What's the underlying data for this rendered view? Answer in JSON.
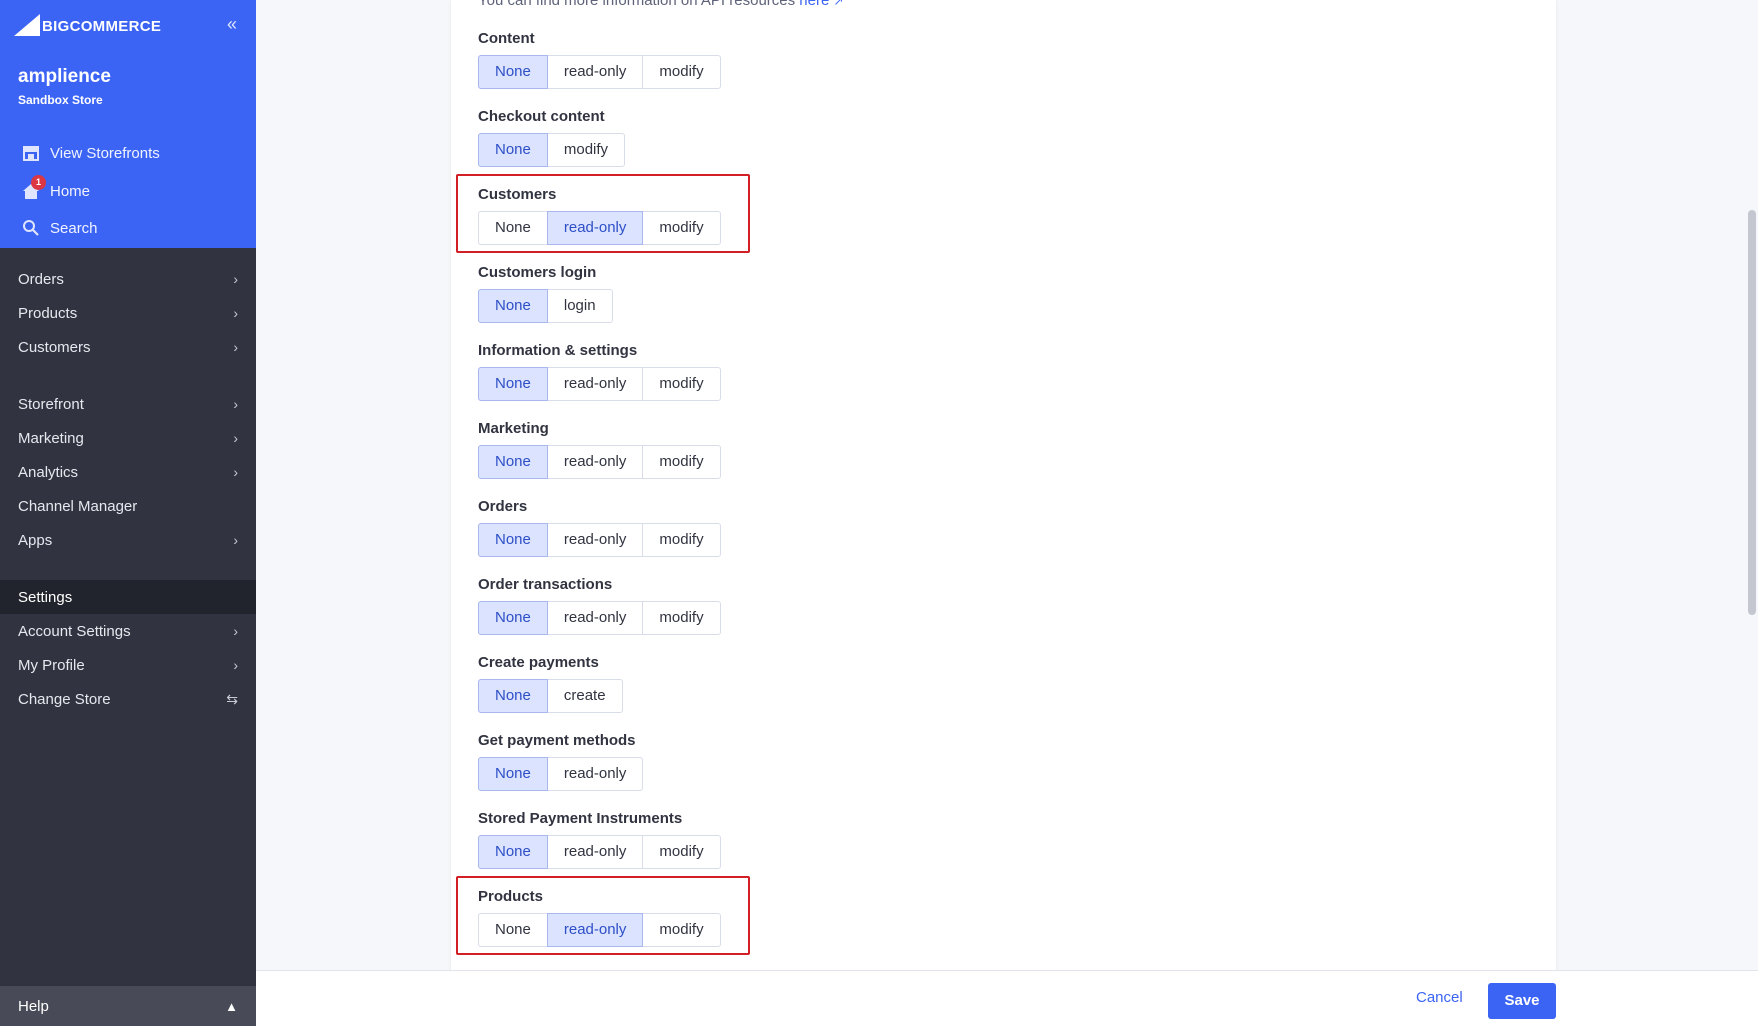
{
  "brand": {
    "logo_text": "BIGCOMMERCE"
  },
  "store": {
    "name": "amplience",
    "type": "Sandbox Store"
  },
  "top_nav": [
    {
      "label": "View Storefronts",
      "icon": "storefront-icon"
    },
    {
      "label": "Home",
      "icon": "home-icon",
      "badge": "1"
    },
    {
      "label": "Search",
      "icon": "search-icon"
    }
  ],
  "nav": {
    "orders": "Orders",
    "products": "Products",
    "customers": "Customers",
    "storefront": "Storefront",
    "marketing": "Marketing",
    "analytics": "Analytics",
    "channel_manager": "Channel Manager",
    "apps": "Apps",
    "settings": "Settings",
    "account_settings": "Account Settings",
    "my_profile": "My Profile",
    "change_store": "Change Store",
    "help": "Help"
  },
  "info": {
    "text": "You can find more information on API resources ",
    "link": "here"
  },
  "scopes": [
    {
      "label": "Content",
      "options": [
        "None",
        "read-only",
        "modify"
      ],
      "selected": "None"
    },
    {
      "label": "Checkout content",
      "options": [
        "None",
        "modify"
      ],
      "selected": "None"
    },
    {
      "label": "Customers",
      "options": [
        "None",
        "read-only",
        "modify"
      ],
      "selected": "read-only",
      "highlighted": true
    },
    {
      "label": "Customers login",
      "options": [
        "None",
        "login"
      ],
      "selected": "None"
    },
    {
      "label": "Information & settings",
      "options": [
        "None",
        "read-only",
        "modify"
      ],
      "selected": "None"
    },
    {
      "label": "Marketing",
      "options": [
        "None",
        "read-only",
        "modify"
      ],
      "selected": "None"
    },
    {
      "label": "Orders",
      "options": [
        "None",
        "read-only",
        "modify"
      ],
      "selected": "None"
    },
    {
      "label": "Order transactions",
      "options": [
        "None",
        "read-only",
        "modify"
      ],
      "selected": "None"
    },
    {
      "label": "Create payments",
      "options": [
        "None",
        "create"
      ],
      "selected": "None"
    },
    {
      "label": "Get payment methods",
      "options": [
        "None",
        "read-only"
      ],
      "selected": "None"
    },
    {
      "label": "Stored Payment Instruments",
      "options": [
        "None",
        "read-only",
        "modify"
      ],
      "selected": "None"
    },
    {
      "label": "Products",
      "options": [
        "None",
        "read-only",
        "modify"
      ],
      "selected": "read-only",
      "highlighted": true
    }
  ],
  "footer": {
    "cancel": "Cancel",
    "save": "Save"
  },
  "colors": {
    "primary": "#3c64f4",
    "sidebar": "#313440",
    "highlight": "#d21f26",
    "selected_bg": "#dbe3fe"
  }
}
